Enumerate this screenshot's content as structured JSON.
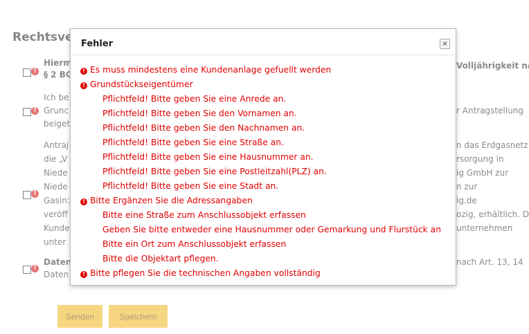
{
  "page": {
    "title": "Rechtsver",
    "buttons": {
      "send": "Senden",
      "save": "Speichern"
    },
    "rows": [
      {
        "left": [
          "Hierm",
          "§ 2 BG"
        ],
        "right": [
          "Volljährigkeit nach"
        ]
      },
      {
        "left": [
          "Ich be",
          "Grunc",
          "beiget"
        ],
        "right": [
          "r Antragstellung"
        ]
      },
      {
        "left": [
          "Antraj",
          "die „V",
          "Niede",
          "Niede",
          "Gasin:",
          "veröff",
          "Kunde",
          "unter"
        ],
        "right": [
          "n das Erdgasnetz",
          "rsorgung in",
          "ig GmbH zur",
          "n zur",
          "ig.de",
          "ozig, erhältlich. Die",
          "unternehmen"
        ]
      },
      {
        "left": [
          "Daten",
          "Daten"
        ],
        "right": [
          "nach Art. 13, 14"
        ]
      }
    ]
  },
  "dialog": {
    "title": "Fehler",
    "close_glyph": "×",
    "errors": [
      {
        "type": "top",
        "text": "Es muss mindestens eine Kundenanlage gefuellt werden"
      },
      {
        "type": "top",
        "text": "Grundstückseigentümer"
      },
      {
        "type": "sub",
        "text": "Pflichtfeld! Bitte geben Sie eine Anrede an."
      },
      {
        "type": "sub",
        "text": "Pflichtfeld! Bitte geben Sie den Vornamen an."
      },
      {
        "type": "sub",
        "text": "Pflichtfeld! Bitte geben Sie den Nachnamen an."
      },
      {
        "type": "sub",
        "text": "Pflichtfeld! Bitte geben Sie eine Straße an."
      },
      {
        "type": "sub",
        "text": "Pflichtfeld! Bitte geben Sie eine Hausnummer an."
      },
      {
        "type": "sub",
        "text": "Pflichtfeld! Bitte geben Sie eine Postleitzahl(PLZ) an."
      },
      {
        "type": "sub",
        "text": "Pflichtfeld! Bitte geben Sie eine Stadt an."
      },
      {
        "type": "top",
        "text": "Bitte Ergänzen Sie die Adressangaben"
      },
      {
        "type": "sub",
        "text": "Bitte eine Straße zum Anschlussobjekt erfassen"
      },
      {
        "type": "sub",
        "text": "Geben Sie bitte entweder eine Hausnummer oder Gemarkung und Flurstück an"
      },
      {
        "type": "sub",
        "text": "Bitte ein Ort zum Anschlussobjekt erfassen"
      },
      {
        "type": "sub",
        "text": "Bitte die Objektart pflegen."
      },
      {
        "type": "top",
        "text": "Bitte pflegen Sie die technischen Angaben vollständig"
      }
    ]
  },
  "colors": {
    "error": "#e00000",
    "button": "#f0b41c"
  },
  "icons": {
    "error": "exclamation-circle-icon",
    "checkbox": "checkbox-icon",
    "close": "close-icon"
  }
}
